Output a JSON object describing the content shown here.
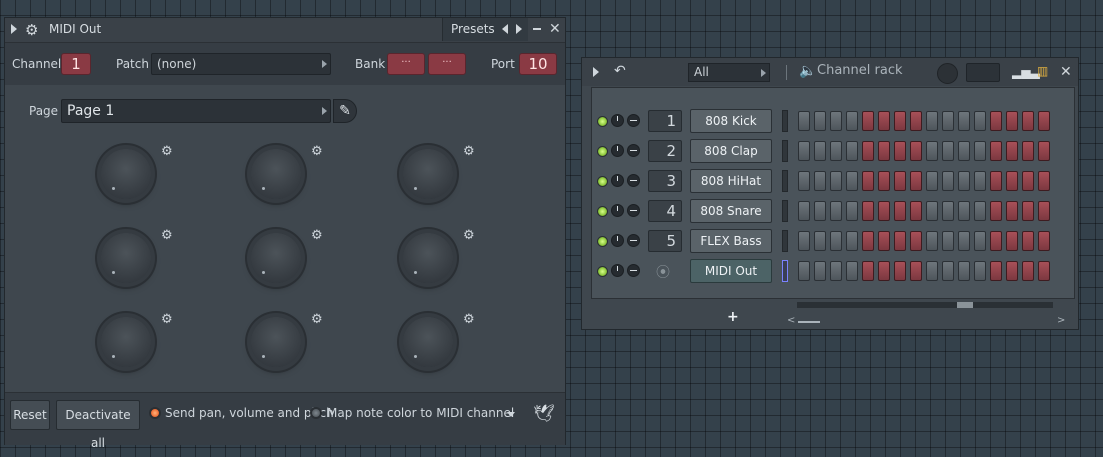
{
  "midi_out": {
    "title": "MIDI Out",
    "presets_label": "Presets",
    "channel_label": "Channel",
    "channel_value": "1",
    "patch_label": "Patch",
    "patch_value": "(none)",
    "bank_label": "Bank",
    "bank_values": [
      "···",
      "···"
    ],
    "port_label": "Port",
    "port_value": "10",
    "page_label": "Page",
    "page_value": "Page 1",
    "buttons": {
      "reset": "Reset",
      "deactivate_all": "Deactivate all"
    },
    "options": {
      "send_pan": "Send pan, volume and pitch",
      "map_note_color": "Map note color to MIDI channel"
    }
  },
  "channel_rack": {
    "title": "Channel rack",
    "filter_value": "All",
    "channels": [
      {
        "number": "1",
        "name": "808 Kick"
      },
      {
        "number": "2",
        "name": "808 Clap"
      },
      {
        "number": "3",
        "name": "808 HiHat"
      },
      {
        "number": "4",
        "name": "808 Snare"
      },
      {
        "number": "5",
        "name": "FLEX Bass"
      },
      {
        "number": "",
        "name": "MIDI Out"
      }
    ],
    "add_label": "+",
    "scroll_left": "<",
    "scroll_right": ">"
  },
  "colors": {
    "accent_red": "#8a3a44",
    "led_green": "#8cc63c",
    "radio_orange": "#f0723a"
  },
  "icons": [
    "gear-icon",
    "pencil-icon",
    "speaker-icon",
    "undo-icon",
    "bird-icon",
    "midi-port-icon"
  ]
}
